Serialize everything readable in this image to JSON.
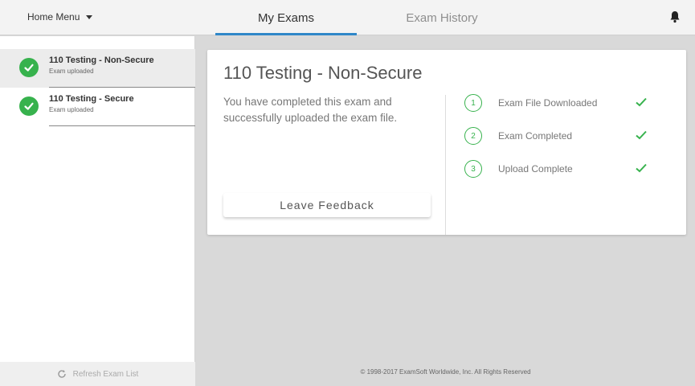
{
  "header": {
    "home_menu_label": "Home Menu",
    "tabs": [
      {
        "label": "My Exams",
        "active": true
      },
      {
        "label": "Exam History",
        "active": false
      }
    ],
    "bell_icon": "bell-icon"
  },
  "sidebar": {
    "items": [
      {
        "title": "110 Testing - Non-Secure",
        "status": "Exam uploaded",
        "selected": true
      },
      {
        "title": "110 Testing - Secure",
        "status": "Exam uploaded",
        "selected": false
      }
    ],
    "refresh_label": "Refresh Exam List",
    "refresh_icon": "refresh-icon"
  },
  "exam": {
    "title": "110 Testing - Non-Secure",
    "message": "You have completed this exam and successfully uploaded the exam file.",
    "feedback_label": "Leave Feedback",
    "steps": [
      {
        "number": "1",
        "label": "Exam File Downloaded",
        "done": true
      },
      {
        "number": "2",
        "label": "Exam Completed",
        "done": true
      },
      {
        "number": "3",
        "label": "Upload Complete",
        "done": true
      }
    ]
  },
  "footer": {
    "copyright": "© 1998-2017 ExamSoft Worldwide, Inc. All Rights Reserved"
  },
  "colors": {
    "accent": "#2f87c8",
    "success": "#37b24d",
    "background": "#d9d9d9"
  }
}
